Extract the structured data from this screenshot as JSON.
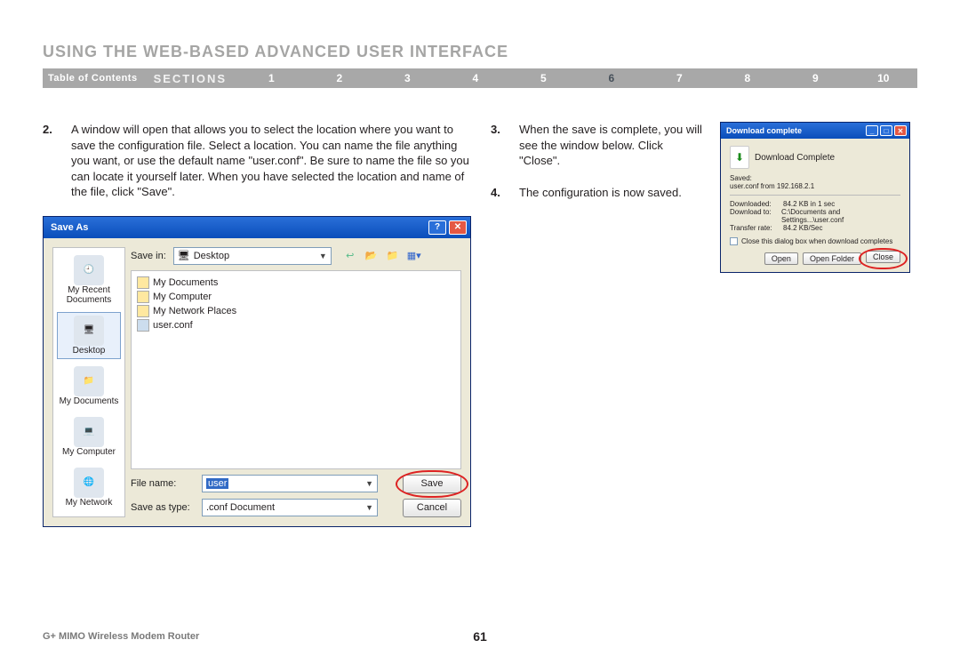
{
  "header": {
    "title": "USING THE WEB-BASED ADVANCED USER INTERFACE",
    "toc": "Table of Contents",
    "sections_label": "SECTIONS",
    "sections": [
      "1",
      "2",
      "3",
      "4",
      "5",
      "6",
      "7",
      "8",
      "9",
      "10"
    ],
    "active_section": "6"
  },
  "steps": {
    "s2": {
      "num": "2.",
      "text": "A window will open that allows you to select the location where you want to save the configuration file. Select a location. You can name the file anything you want, or use the default name \"user.conf\". Be sure to name the file so you can locate it yourself later. When you have selected the location and name of the file, click \"Save\"."
    },
    "s3": {
      "num": "3.",
      "text": "When the save is complete, you will see the window below. Click \"Close\"."
    },
    "s4": {
      "num": "4.",
      "text": "The configuration is now saved."
    }
  },
  "save_as": {
    "title": "Save As",
    "save_in_label": "Save in:",
    "save_in_value": "Desktop",
    "places": [
      "My Recent Documents",
      "Desktop",
      "My Documents",
      "My Computer",
      "My Network"
    ],
    "files": [
      "My Documents",
      "My Computer",
      "My Network Places",
      "user.conf"
    ],
    "file_name_label": "File name:",
    "file_name_value": "user",
    "save_as_type_label": "Save as type:",
    "save_as_type_value": ".conf Document",
    "save_btn": "Save",
    "cancel_btn": "Cancel"
  },
  "download": {
    "title": "Download complete",
    "heading": "Download Complete",
    "saved_label": "Saved:",
    "saved_value": "user.conf from 192.168.2.1",
    "stats_downloaded_k": "Downloaded:",
    "stats_downloaded_v": "84.2 KB in 1 sec",
    "stats_to_k": "Download to:",
    "stats_to_v": "C:\\Documents and Settings...\\user.conf",
    "stats_rate_k": "Transfer rate:",
    "stats_rate_v": "84.2 KB/Sec",
    "checkbox": "Close this dialog box when download completes",
    "open_btn": "Open",
    "open_folder_btn": "Open Folder",
    "close_btn": "Close"
  },
  "footer": {
    "product": "G+ MIMO Wireless Modem Router",
    "page": "61"
  }
}
